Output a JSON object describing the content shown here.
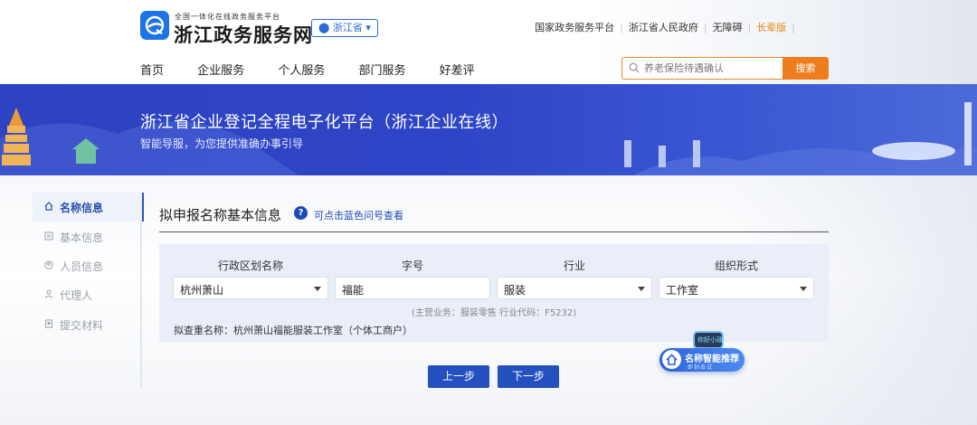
{
  "header": {
    "logo_subtitle": "全国一体化在线政务服务平台",
    "logo_title": "浙江政务服务网",
    "region": "浙江省",
    "top_links": [
      "国家政务服务平台",
      "浙江省人民政府",
      "无障碍",
      "长辈版"
    ],
    "nav": [
      "首页",
      "企业服务",
      "个人服务",
      "部门服务",
      "好差评"
    ],
    "search": {
      "placeholder": "养老保险待遇确认",
      "button": "搜索"
    }
  },
  "banner": {
    "title": "浙江省企业登记全程电子化平台（浙江企业在线）",
    "subtitle": "智能导服，为您提供准确办事引导"
  },
  "sidebar": {
    "items": [
      {
        "label": "名称信息",
        "icon": "home-icon",
        "active": true
      },
      {
        "label": "基本信息",
        "icon": "document-icon",
        "active": false
      },
      {
        "label": "人员信息",
        "icon": "person-circle-icon",
        "active": false
      },
      {
        "label": "代理人",
        "icon": "user-icon",
        "active": false
      },
      {
        "label": "提交材料",
        "icon": "file-icon",
        "active": false
      }
    ]
  },
  "form": {
    "section_title": "拟申报名称基本信息",
    "help_icon": "?",
    "help_hint": "可点击蓝色问号查看",
    "columns": [
      "行政区划名称",
      "字号",
      "行业",
      "组织形式"
    ],
    "values": {
      "district": "杭州萧山",
      "brand": "福能",
      "industry": "服装",
      "org_form": "工作室"
    },
    "business_note": "(主营业务：服装零售  行业代码：F5232)",
    "check_name": "拟查重名称：杭州萧山福能服装工作室（个体工商户）"
  },
  "buttons": {
    "prev": "上一步",
    "next": "下一步"
  },
  "assistant": {
    "title": "名称智能推荐",
    "subtitle": "即刻去试",
    "screen_text": "你好小政"
  },
  "colors": {
    "primary": "#2450c0",
    "banner": "#2e43c2",
    "accent": "#ee7d1d"
  }
}
